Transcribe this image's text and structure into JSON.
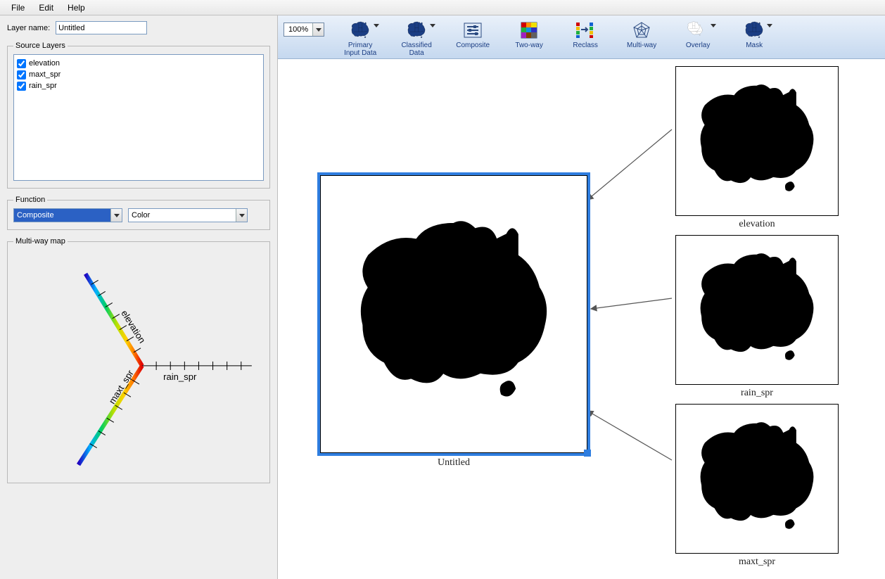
{
  "menu": {
    "items": [
      "File",
      "Edit",
      "Help"
    ]
  },
  "form": {
    "layer_name_label": "Layer name:",
    "layer_name_value": "Untitled"
  },
  "groups": {
    "source_layers": "Source Layers",
    "function": "Function",
    "multiway": "Multi-way map"
  },
  "source_layers": [
    {
      "label": "elevation",
      "checked": true
    },
    {
      "label": "maxt_spr",
      "checked": true
    },
    {
      "label": "rain_spr",
      "checked": true
    }
  ],
  "function": {
    "primary": "Composite",
    "secondary": "Color"
  },
  "multiway_axes": [
    "elevation",
    "rain_spr",
    "maxt_spr"
  ],
  "toolbar": {
    "zoom": "100%",
    "items": [
      {
        "id": "primary-input-data",
        "label": "Primary\nInput Data",
        "dropdown": true
      },
      {
        "id": "classified-data",
        "label": "Classified\nData",
        "dropdown": true
      },
      {
        "id": "composite",
        "label": "Composite",
        "dropdown": false
      },
      {
        "id": "two-way",
        "label": "Two-way",
        "dropdown": false
      },
      {
        "id": "reclass",
        "label": "Reclass",
        "dropdown": false
      },
      {
        "id": "multi-way",
        "label": "Multi-way",
        "dropdown": false
      },
      {
        "id": "overlay",
        "label": "Overlay",
        "dropdown": true
      },
      {
        "id": "mask",
        "label": "Mask",
        "dropdown": true
      }
    ]
  },
  "canvas": {
    "main_map": {
      "caption": "Untitled",
      "selected": true
    },
    "thumbnails": [
      {
        "id": "elevation",
        "caption": "elevation"
      },
      {
        "id": "rain_spr",
        "caption": "rain_spr"
      },
      {
        "id": "maxt_spr",
        "caption": "maxt_spr"
      }
    ]
  }
}
